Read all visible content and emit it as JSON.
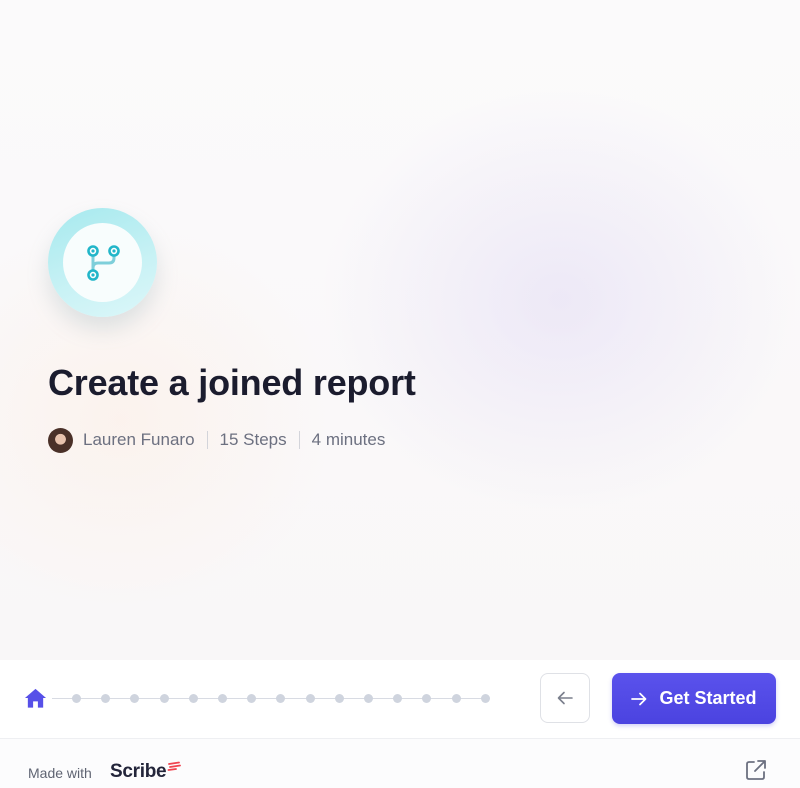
{
  "guide": {
    "title": "Create a joined report",
    "author": "Lauren Funaro",
    "steps": "15 Steps",
    "duration": "4 minutes"
  },
  "progress": {
    "total_steps": 15,
    "current_step": 0
  },
  "navigation": {
    "back_icon": "arrow-left-icon",
    "start_label": "Get Started",
    "start_icon": "arrow-right-icon"
  },
  "footer": {
    "made_with": "Made with",
    "brand": "Scribe",
    "external_icon": "external-link-icon"
  },
  "colors": {
    "accent": "#4f47e6",
    "home_icon": "#5750e8",
    "logo_teal": "#22b6c9",
    "title": "#1b1c2e",
    "brand_red": "#f0434f"
  },
  "icons": {
    "logo": "workflow-branch-icon",
    "home": "home-icon",
    "avatar": "author-avatar"
  }
}
